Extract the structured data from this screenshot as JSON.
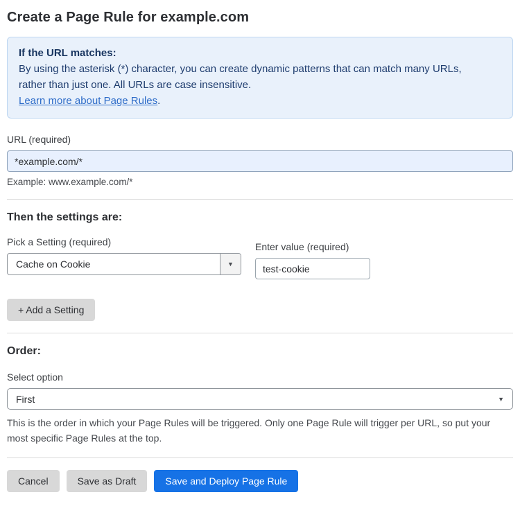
{
  "page": {
    "title": "Create a Page Rule for example.com"
  },
  "info_box": {
    "heading": "If the URL matches:",
    "body": "By using the asterisk (*) character, you can create dynamic patterns that can match many URLs, rather than just one. All URLs are case insensitive.",
    "link_label": "Learn more about Page Rules",
    "link_suffix": "."
  },
  "url_field": {
    "label": "URL (required)",
    "value": "*example.com/*",
    "helper": "Example: www.example.com/*"
  },
  "settings_section": {
    "heading": "Then the settings are:",
    "setting_label": "Pick a Setting (required)",
    "setting_value": "Cache on Cookie",
    "value_label": "Enter value (required)",
    "value_value": "test-cookie",
    "add_button_label": "+ Add a Setting",
    "dropdown_arrow": "▼"
  },
  "order_section": {
    "heading": "Order:",
    "select_label": "Select option",
    "selected_option": "First",
    "dropdown_arrow": "▼",
    "helper": "This is the order in which your Page Rules will be triggered. Only one Page Rule will trigger per URL, so put your most specific Page Rules at the top."
  },
  "actions": {
    "cancel_label": "Cancel",
    "save_draft_label": "Save as Draft",
    "save_deploy_label": "Save and Deploy Page Rule"
  },
  "colors": {
    "info_bg": "#e9f1fb",
    "info_border": "#bed7f1",
    "info_text": "#1e3c6e",
    "link_blue": "#2c6bc8",
    "url_input_bg": "#e8f0fe",
    "primary_button_bg": "#1672e6",
    "gray_button_bg": "#d8d8d8"
  }
}
